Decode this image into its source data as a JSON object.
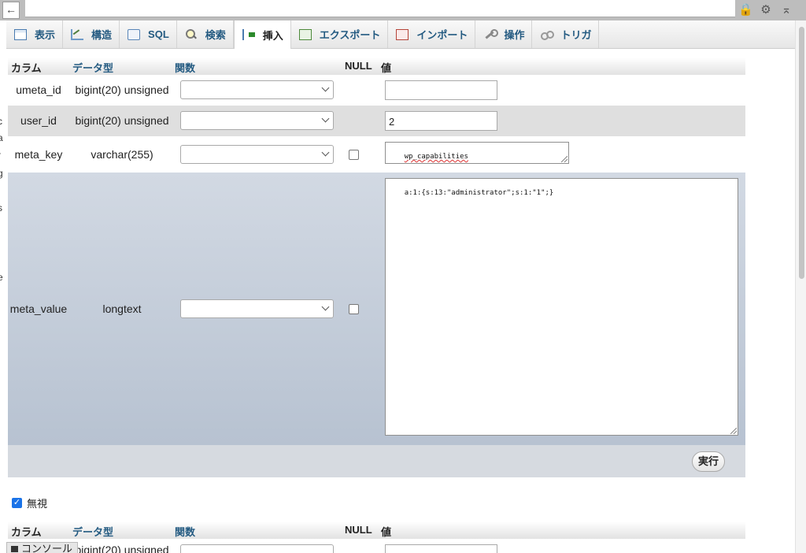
{
  "browser": {
    "back_glyph": "←",
    "icons": [
      "lock-icon",
      "gear-icon",
      "collapse-icon"
    ]
  },
  "tabs": [
    {
      "label": "表示",
      "icon": "table-icon",
      "active": false
    },
    {
      "label": "構造",
      "icon": "structure-icon",
      "active": false
    },
    {
      "label": "SQL",
      "icon": "sql-icon",
      "active": false
    },
    {
      "label": "検索",
      "icon": "search-icon",
      "active": false
    },
    {
      "label": "挿入",
      "icon": "insert-icon",
      "active": true
    },
    {
      "label": "エクスポート",
      "icon": "export-icon",
      "active": false
    },
    {
      "label": "インポート",
      "icon": "import-icon",
      "active": false
    },
    {
      "label": "操作",
      "icon": "wrench-icon",
      "active": false
    },
    {
      "label": "トリガ",
      "icon": "trigger-icon",
      "active": false
    }
  ],
  "form": {
    "headers": {
      "column": "カラム",
      "type": "データ型",
      "function": "関数",
      "null": "NULL",
      "value": "値"
    },
    "rows": [
      {
        "name": "umeta_id",
        "type": "bigint(20) unsigned",
        "function": "",
        "null_box": false,
        "value": ""
      },
      {
        "name": "user_id",
        "type": "bigint(20) unsigned",
        "function": "",
        "null_box": false,
        "value": "2"
      },
      {
        "name": "meta_key",
        "type": "varchar(255)",
        "function": "",
        "null_box": true,
        "null_checked": false,
        "value": "wp_capabilities"
      },
      {
        "name": "meta_value",
        "type": "longtext",
        "function": "",
        "null_box": true,
        "null_checked": false,
        "value": "a:1:{s:13:\"administrator\";s:1:\"1\";}"
      }
    ],
    "go_label": "実行"
  },
  "ignore": {
    "label": "無視",
    "checked": true
  },
  "second_form": {
    "headers": {
      "column": "カラム",
      "type": "データ型",
      "function": "関数",
      "null": "NULL",
      "value": "値"
    },
    "first_row_type": "bigint(20) unsigned"
  },
  "console": {
    "label": "コンソール"
  },
  "left_cut_chars": [
    "c",
    "a",
    "r",
    "g",
    "s",
    "e"
  ]
}
